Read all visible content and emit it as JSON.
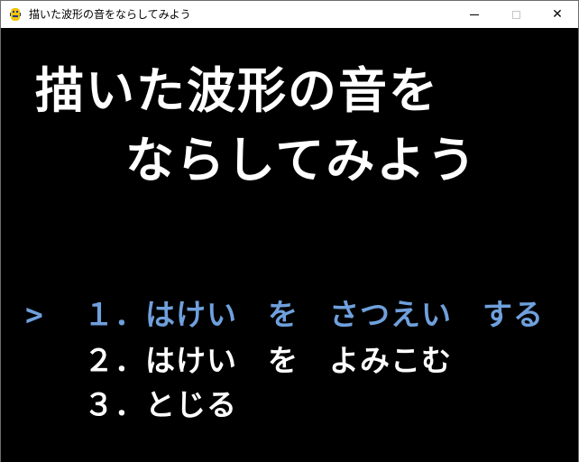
{
  "window": {
    "title": "描いた波形の音をならしてみよう",
    "icon": "pygame-snake-icon",
    "minimize_icon": "minimize-icon",
    "maximize_icon": "maximize-icon",
    "close_icon": "close-icon",
    "close_glyph": "✕"
  },
  "screen": {
    "title_line1": "描いた波形の音を",
    "title_line2": "ならしてみよう",
    "cursor": ">",
    "menu": [
      {
        "label": "１．はけい　を　さつえい　する",
        "selected": true
      },
      {
        "label": "２．はけい　を　よみこむ",
        "selected": false
      },
      {
        "label": "３．とじる",
        "selected": false
      }
    ]
  },
  "colors": {
    "background": "#000000",
    "text": "#ffffff",
    "selected": "#6fa0dc",
    "titlebar": "#ffffff"
  }
}
